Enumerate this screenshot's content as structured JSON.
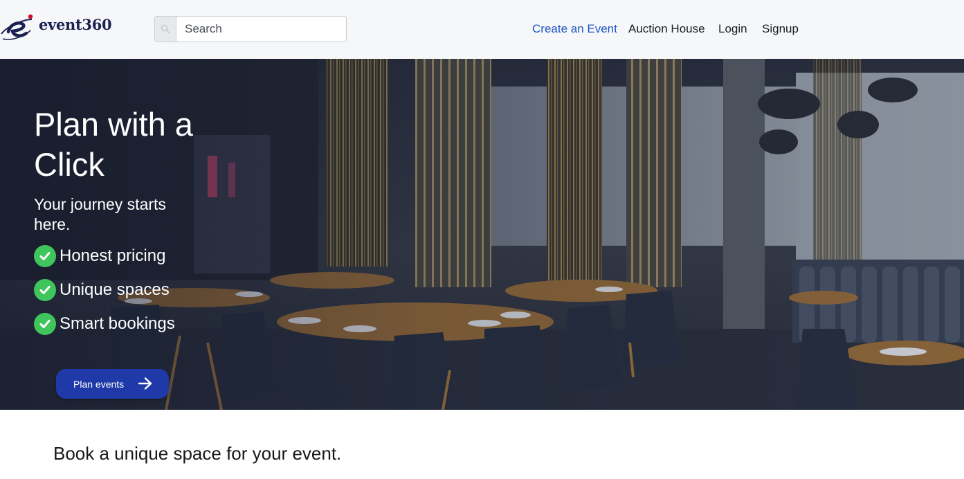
{
  "brand": {
    "logo_text": "event360"
  },
  "search": {
    "placeholder": "Search"
  },
  "nav": {
    "items": [
      {
        "label": "Create an Event"
      },
      {
        "label": "Auction House"
      },
      {
        "label": "Login"
      },
      {
        "label": "Signup"
      }
    ],
    "active_color": "#1f55c4"
  },
  "hero": {
    "title": "Plan with a Click",
    "subtitle": "Your journey starts here.",
    "features": [
      {
        "label": "Honest pricing"
      },
      {
        "label": "Unique spaces"
      },
      {
        "label": "Smart bookings"
      }
    ],
    "cta_label": "Plan events",
    "check_color": "#3fc55c",
    "cta_color": "#1f3aa8"
  },
  "section": {
    "heading": "Book a unique space for your event."
  }
}
